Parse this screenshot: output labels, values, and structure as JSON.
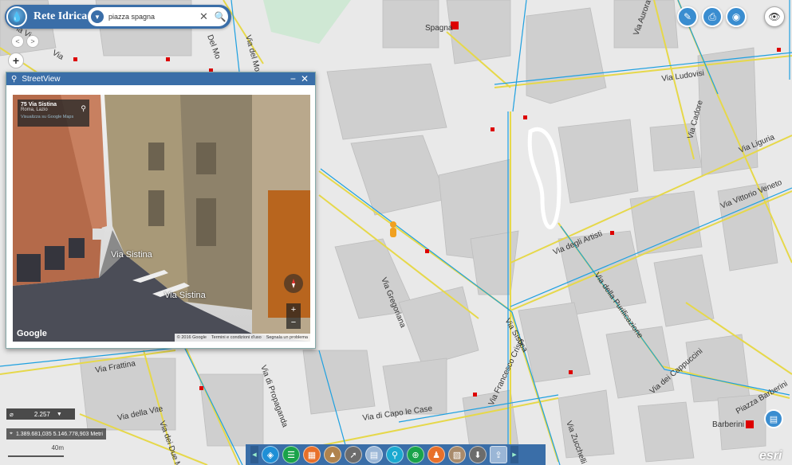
{
  "app": {
    "title": "Rete Idrica",
    "logo_icon": "drop-logo-icon"
  },
  "search": {
    "value": "piazza spagna",
    "placeholder": ""
  },
  "map": {
    "labels": {
      "spagna": "Spagna",
      "via_aurora": "Via Aurora",
      "via_ludovisi": "Via Ludovisi",
      "via_cadore": "Via Cadore",
      "via_liguria": "Via Liguria",
      "via_vittorio_veneto": "Via Vittorio Veneto",
      "via_degli_artisti": "Via degli Artisti",
      "via_della_purificazione": "Via della Purificazione",
      "via_gregoriana": "Via Gregoriana",
      "via_sistina": "Via Sistina",
      "via_francesco_crispi": "Via Francesco Crispi",
      "via_dei_cappuccini": "Via dei Cappuccini",
      "via_capo_le_case": "Via di Capo le Case",
      "via_di_propaganda": "Via di Propaganda",
      "via_frattina": "Via Frattina",
      "via_della_vite": "Via della Vite",
      "via_zucchelli": "Via Zucchelli",
      "piazza_barberini": "Piazza Barberini",
      "barberini": "Barberini",
      "via_del_mortaro": "Via del Mortaro",
      "via_dei_due_macelli": "Via dei Due Macelli",
      "la_via": "la Via",
      "del_mo": "Del Mo",
      "via_left_top": "Via"
    },
    "colors": {
      "pipe": "#1ea0e0",
      "road": "#e6d84a",
      "block": "#cfcfcf",
      "park": "#cfe8d4"
    }
  },
  "streetview": {
    "title": "StreetView",
    "address": "75 Via Sistina",
    "city": "Roma, Lazio",
    "gmaps_link": "Visualizza su Google Maps",
    "street_label": "Via Sistina",
    "google": "Google",
    "copyright": "© 2016 Google",
    "terms": "Termini e condizioni d'uso",
    "report": "Segnala un problema"
  },
  "scale": {
    "value": "2.257"
  },
  "coords": "1.389.681,035 5.146.778,903 Metri",
  "scalebar": "40m",
  "esri": "esri",
  "toolbar": [
    "layers",
    "legend",
    "grid",
    "measure",
    "identify",
    "table",
    "search",
    "zoom-search",
    "streetview",
    "print-map",
    "download",
    "export"
  ]
}
